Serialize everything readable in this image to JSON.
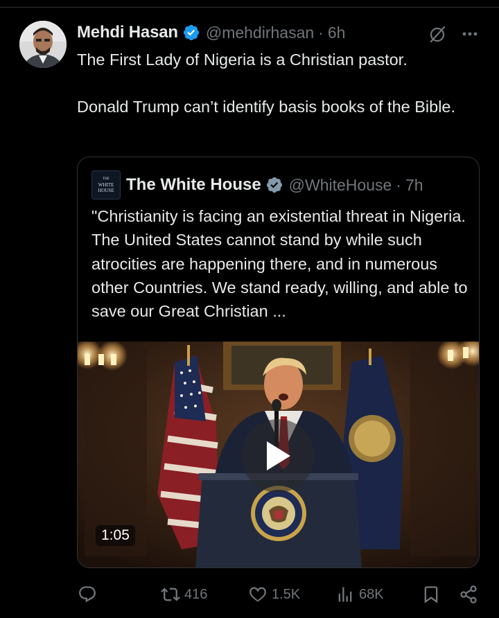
{
  "tweet": {
    "author": {
      "name": "Mehdi Hasan",
      "handle": "@mehdirhasan",
      "time": "6h"
    },
    "text": "The First Lady of Nigeria is a Christian pastor.\n\nDonald Trump can’t identify basis books of the Bible."
  },
  "quote": {
    "author": {
      "name": "The White House",
      "handle": "@WhiteHouse",
      "time": "7h",
      "logo_line1": "THE",
      "logo_line2": "WHITE",
      "logo_line3": "HOUSE"
    },
    "text": "\"Christianity is facing an existential threat in Nigeria. The United States cannot stand by while such atrocities are happening there, and in numerous other Countries. We stand ready, willing, and able to save our Great Christian ...",
    "video": {
      "duration": "1:05"
    }
  },
  "actions": {
    "reply": "",
    "reposts": "416",
    "likes": "1.5K",
    "views": "68K"
  },
  "icons": {
    "verified_color": "#1d9bf0",
    "quote_verified_color": "#829aab",
    "muted_text": "#71767b"
  }
}
